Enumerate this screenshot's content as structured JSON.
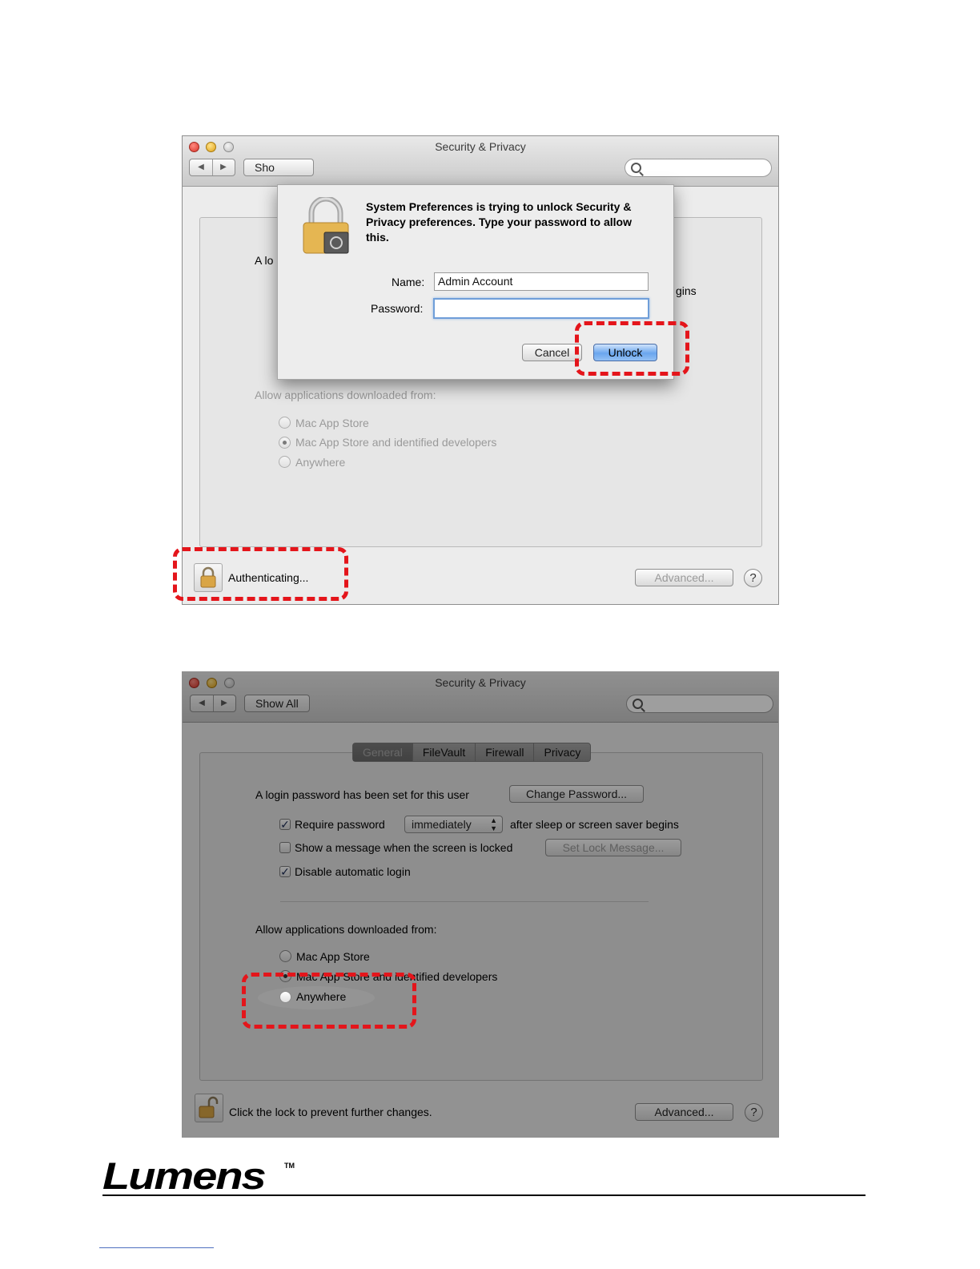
{
  "window1": {
    "title": "Security & Privacy",
    "show_all_partial": "Sho",
    "login_partial": "A lo",
    "begins_partial": "gins",
    "allow_heading": "Allow applications downloaded from:",
    "radios": [
      {
        "label": "Mac App Store",
        "selected": false
      },
      {
        "label": "Mac App Store and identified developers",
        "selected": true
      },
      {
        "label": "Anywhere",
        "selected": false
      }
    ],
    "status_text": "Authenticating...",
    "advanced_label": "Advanced...",
    "help_label": "?",
    "dialog": {
      "message": "System Preferences is trying to unlock Security & Privacy preferences. Type your password to allow this.",
      "name_label": "Name:",
      "name_value": "Admin Account",
      "password_label": "Password:",
      "password_value": "",
      "cancel_label": "Cancel",
      "unlock_label": "Unlock"
    }
  },
  "window2": {
    "title": "Security & Privacy",
    "show_all_label": "Show All",
    "tabs": [
      {
        "label": "General",
        "selected": true
      },
      {
        "label": "FileVault",
        "selected": false
      },
      {
        "label": "Firewall",
        "selected": false
      },
      {
        "label": "Privacy",
        "selected": false
      }
    ],
    "login_text": "A login password has been set for this user",
    "change_password_label": "Change Password...",
    "require_password": {
      "label": "Require password",
      "checked": true,
      "select_value": "immediately",
      "suffix": "after sleep or screen saver begins"
    },
    "show_message": {
      "label": "Show a message when the screen is locked",
      "checked": false,
      "button_label": "Set Lock Message..."
    },
    "disable_login": {
      "label": "Disable automatic login",
      "checked": true
    },
    "allow_heading": "Allow applications downloaded from:",
    "radios": [
      {
        "label": "Mac App Store",
        "selected": false
      },
      {
        "label": "Mac App Store and identified developers",
        "selected": true
      },
      {
        "label": "Anywhere",
        "selected": false
      }
    ],
    "status_text": "Click the lock to prevent further changes.",
    "advanced_label": "Advanced...",
    "help_label": "?"
  },
  "footer": {
    "logo_text": "Lumens",
    "tm": "TM"
  },
  "colors": {
    "highlight_dash": "#e4151b",
    "focus_ring": "#6f9ed9",
    "unlock_button": "#6aa6ee"
  }
}
